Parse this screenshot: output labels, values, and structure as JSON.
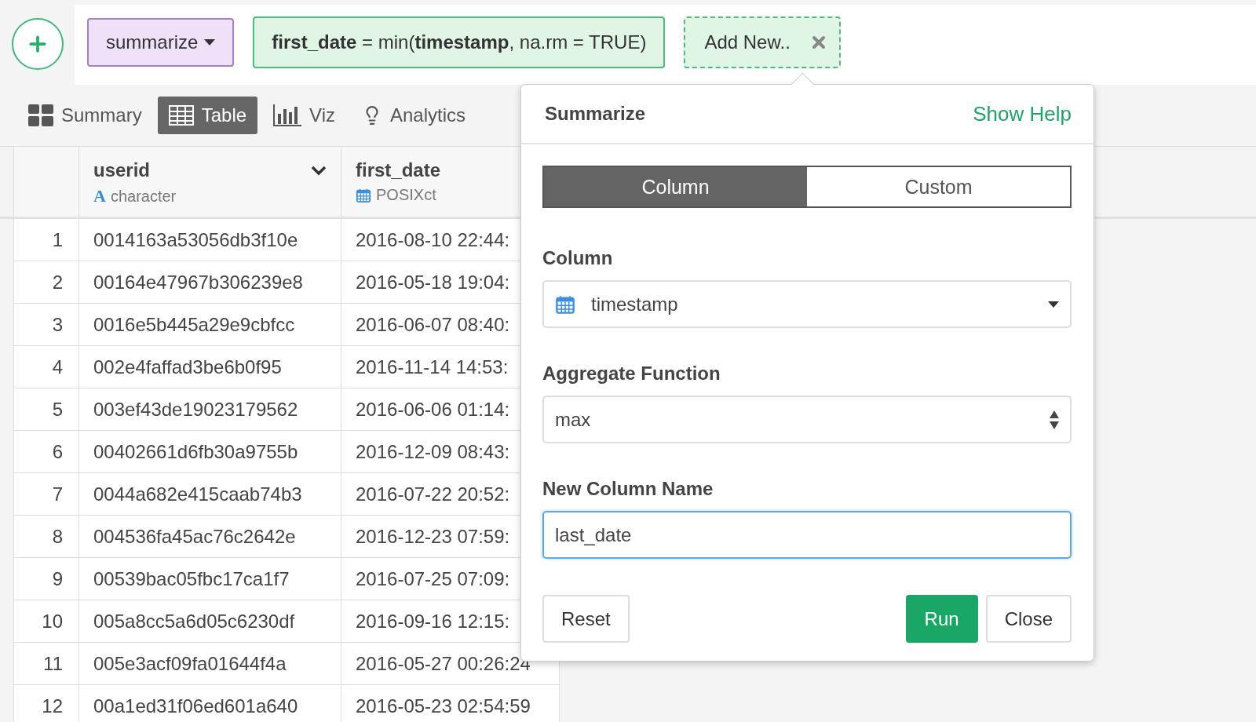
{
  "toolbar": {
    "command": {
      "label": "summarize"
    },
    "expression": "**first_date** = min(**timestamp**, na.rm = TRUE)",
    "add_new": {
      "label": "Add New.."
    }
  },
  "view_tabs": [
    {
      "label": "Summary",
      "kind": "summary",
      "selected": false
    },
    {
      "label": "Table",
      "kind": "table",
      "selected": true
    },
    {
      "label": "Viz",
      "kind": "viz",
      "selected": false
    },
    {
      "label": "Analytics",
      "kind": "analytics",
      "selected": false
    }
  ],
  "table": {
    "columns": [
      {
        "name": "userid",
        "type": "character",
        "kind": "character",
        "type_glyph": "A",
        "has_menu": true
      },
      {
        "name": "first_date",
        "type": "POSIXct",
        "kind": "date"
      }
    ],
    "rows": [
      {
        "index": "1",
        "cells": [
          "0014163a53056db3f10e",
          "2016-08-10 22:44:"
        ]
      },
      {
        "index": "2",
        "cells": [
          "00164e47967b306239e8",
          "2016-05-18 19:04:"
        ]
      },
      {
        "index": "3",
        "cells": [
          "0016e5b445a29e9cbfcc",
          "2016-06-07 08:40:"
        ]
      },
      {
        "index": "4",
        "cells": [
          "002e4faffad3be6b0f95",
          "2016-11-14 14:53:"
        ]
      },
      {
        "index": "5",
        "cells": [
          "003ef43de19023179562",
          "2016-06-06 01:14:"
        ]
      },
      {
        "index": "6",
        "cells": [
          "00402661d6fb30a9755b",
          "2016-12-09 08:43:"
        ]
      },
      {
        "index": "7",
        "cells": [
          "0044a682e415caab74b3",
          "2016-07-22 20:52:"
        ]
      },
      {
        "index": "8",
        "cells": [
          "004536fa45ac76c2642e",
          "2016-12-23 07:59:"
        ]
      },
      {
        "index": "9",
        "cells": [
          "00539bac05fbc17ca1f7",
          "2016-07-25 07:09:"
        ]
      },
      {
        "index": "10",
        "cells": [
          "005a8cc5a6d05c6230df",
          "2016-09-16 12:15:"
        ]
      },
      {
        "index": "11",
        "cells": [
          "005e3acf09fa01644f4a",
          "2016-05-27 00:26:24"
        ]
      },
      {
        "index": "12",
        "cells": [
          "00a1ed31f06ed601a640",
          "2016-05-23 02:54:59"
        ]
      }
    ]
  },
  "popover": {
    "title": "Summarize",
    "help_link": "Show Help",
    "modes": [
      {
        "label": "Column",
        "selected": true
      },
      {
        "label": "Custom",
        "selected": false
      }
    ],
    "fields": [
      {
        "kind": "column-select",
        "label": "Column",
        "value": "timestamp"
      },
      {
        "kind": "select",
        "label": "Aggregate Function",
        "value": "max"
      },
      {
        "kind": "text",
        "label": "New Column Name",
        "value": "last_date",
        "focused": true
      }
    ],
    "buttons": [
      {
        "label": "Reset",
        "kind": "default"
      },
      {
        "label": "Run",
        "kind": "primary"
      },
      {
        "label": "Close",
        "kind": "default"
      }
    ]
  }
}
